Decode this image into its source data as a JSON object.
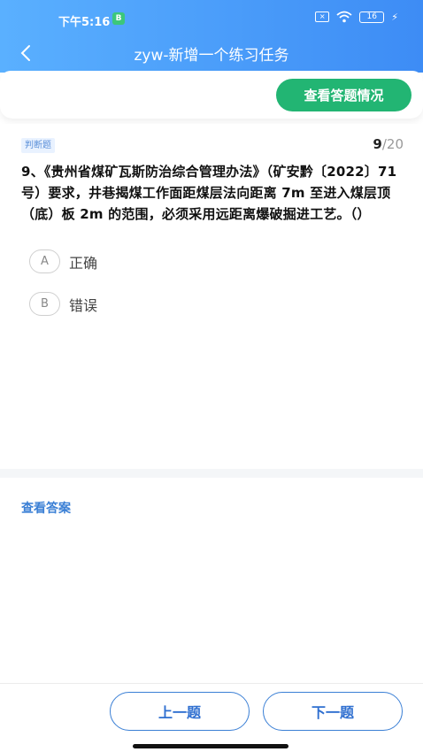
{
  "status_bar": {
    "time": "下午5:16",
    "badge": "B",
    "sim": "×",
    "battery": "16"
  },
  "header": {
    "title": "zyw-新增一个练习任务"
  },
  "toolbar": {
    "view_status_label": "查看答题情况"
  },
  "question": {
    "type_tag": "判断题",
    "current": "9",
    "total": "/20",
    "text": "9、《贵州省煤矿瓦斯防治综合管理办法》（矿安黔〔2022〕71号）要求，井巷揭煤工作面距煤层法向距离 7m 至进入煤层顶（底）板 2m 的范围，必须采用远距离爆破掘进工艺。（）",
    "options": [
      {
        "letter": "A",
        "text": "正确"
      },
      {
        "letter": "B",
        "text": "错误"
      }
    ]
  },
  "answer": {
    "view_answer_label": "查看答案"
  },
  "footer": {
    "prev_label": "上一题",
    "next_label": "下一题"
  },
  "colors": {
    "header_start": "#5ab0ff",
    "header_end": "#3d8cf5",
    "green_button": "#22b573",
    "blue_accent": "#3a7fd5"
  }
}
